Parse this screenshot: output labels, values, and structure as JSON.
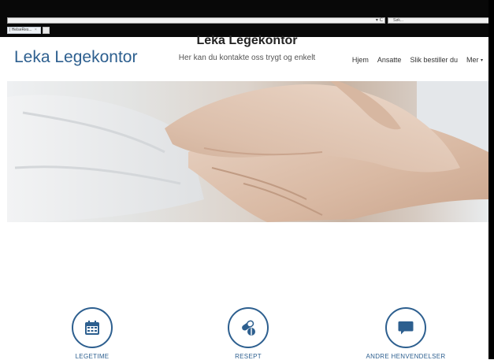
{
  "browser": {
    "tab_title": "| HelseRes...",
    "tab_close": "×",
    "reload_controls": "▾ C",
    "search_placeholder": "Søk..."
  },
  "header": {
    "brand": "Leka Legekontor",
    "nav": [
      {
        "label": "Hjem"
      },
      {
        "label": "Ansatte"
      },
      {
        "label": "Slik bestiller du"
      },
      {
        "label": "Mer"
      }
    ],
    "more_caret": "▾"
  },
  "hero": {
    "image": "handshake"
  },
  "main": {
    "title": "Leka Legekontor",
    "subtitle": "Her kan du kontakte oss trygt og enkelt",
    "services": [
      {
        "label": "LEGETIME",
        "icon": "calendar-icon"
      },
      {
        "label": "RESEPT",
        "icon": "pills-icon"
      },
      {
        "label": "ANDRE HENVENDELSER",
        "icon": "chat-icon"
      }
    ]
  },
  "colors": {
    "accent": "#2d5f8f",
    "chrome": "#080808",
    "text": "#333333"
  }
}
